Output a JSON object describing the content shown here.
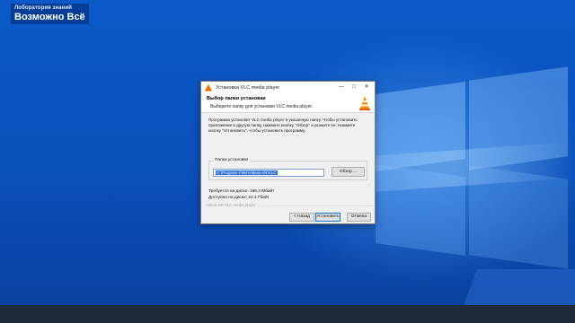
{
  "overlay": {
    "small_text": "Лоборатория знаний",
    "big_text": "Возможно Всё"
  },
  "window": {
    "title": "Установка VLC media player",
    "minimize_glyph": "—",
    "maximize_glyph": "□",
    "close_glyph": "✕"
  },
  "header": {
    "title": "Выбор папки установки",
    "subtitle": "Выберите папку для установки VLC media player."
  },
  "body": {
    "description": "Программа установит VLC media player в указанную папку. Чтобы установить приложение в другую папку, нажмите кнопку \"Обзор\" и укажите ее. Нажмите кнопку \"Установить\", чтобы установить программу.",
    "group_label": "Папка установки",
    "path_value": "C:\\Program Files\\VideoLAN\\VLC",
    "browse_label": "Обзор ...",
    "space_required": "Требуется на диске: 166.4 Мбайт",
    "space_available": "Доступно на диске: 22.4 Гбайт",
    "branding": "VideoLAN VLC media player"
  },
  "buttons": {
    "back": "< Назад",
    "install": "Установить",
    "cancel": "Отмена"
  },
  "colors": {
    "desktop": "#0a4fb8",
    "vlc_orange": "#ff8a00",
    "selection": "#2b6fd6"
  }
}
